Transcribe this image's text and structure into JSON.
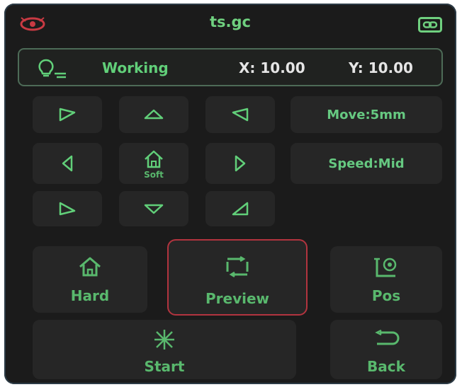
{
  "header": {
    "title": "ts.gc",
    "left_icon": "laser-eye-icon",
    "right_icon": "link-icon"
  },
  "status": {
    "state": "Working",
    "x": "X: 10.00",
    "y": "Y: 10.00",
    "icon": "bulb-icon"
  },
  "jog": {
    "move_label": "Move:5mm",
    "speed_label": "Speed:Mid",
    "soft_label": "Soft",
    "arrow_icons": [
      "arrow-up-left-icon",
      "arrow-up-icon",
      "arrow-up-right-icon",
      "arrow-left-icon",
      "home-soft-icon",
      "arrow-right-icon",
      "arrow-down-left-icon",
      "arrow-down-icon",
      "arrow-down-right-icon"
    ]
  },
  "actions": {
    "hard": "Hard",
    "preview": "Preview",
    "pos": "Pos",
    "start": "Start",
    "back": "Back",
    "selected": "preview"
  },
  "colors": {
    "background": "#1b1b1b",
    "accent": "#59b86d",
    "selection": "#b2343f"
  }
}
